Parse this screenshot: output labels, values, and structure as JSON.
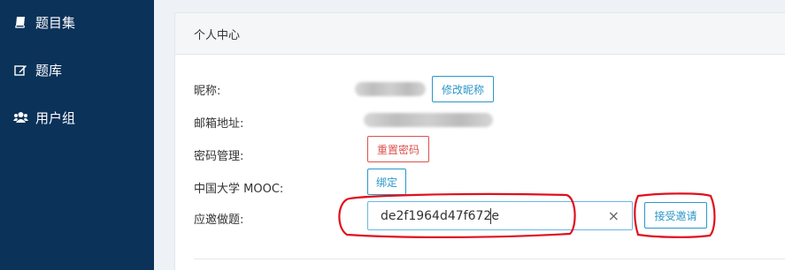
{
  "sidebar": {
    "items": [
      {
        "label": "题目集",
        "icon": "book-icon"
      },
      {
        "label": "题库",
        "icon": "edit-icon"
      },
      {
        "label": "用户组",
        "icon": "users-icon"
      }
    ]
  },
  "card": {
    "title": "个人中心"
  },
  "profile": {
    "nickname_label": "昵称:",
    "edit_nickname_button": "修改昵称",
    "email_label": "邮箱地址:",
    "password_label": "密码管理:",
    "reset_password_button": "重置密码",
    "mooc_label": "中国大学 MOOC:",
    "bind_button": "绑定",
    "invite_label": "应邀做题:",
    "invite_code": "de2f1964d47f672e",
    "clear_icon": "×",
    "accept_invite_button": "接受邀请"
  },
  "colors": {
    "sidebar_bg": "#0b3259",
    "primary": "#2a97c9",
    "danger": "#d9534f",
    "annotation": "#e0101e"
  }
}
